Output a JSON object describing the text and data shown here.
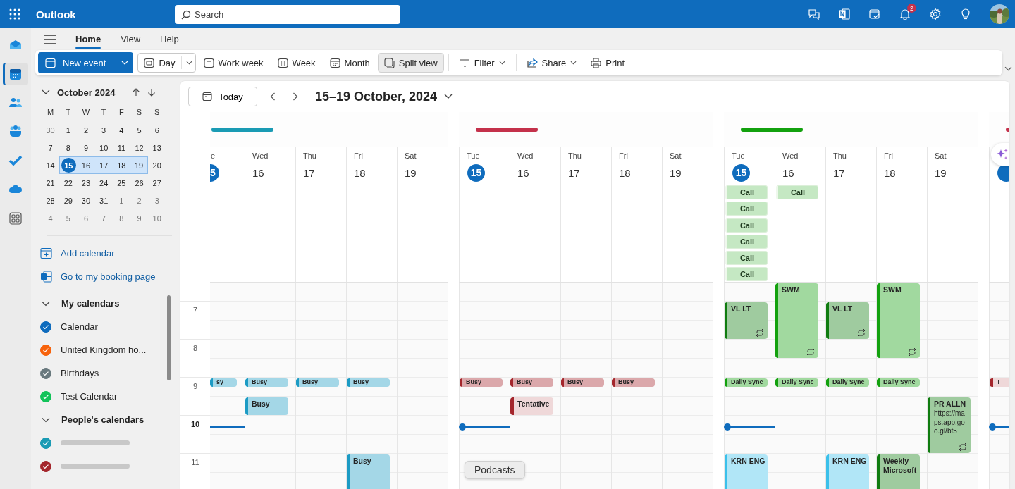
{
  "topbar": {
    "app_name": "Outlook",
    "search": {
      "placeholder": "Search"
    },
    "notification_badge": "2"
  },
  "rail": [
    {
      "kind": "mail",
      "selected": false
    },
    {
      "kind": "calendar",
      "selected": true
    },
    {
      "kind": "people",
      "selected": false
    },
    {
      "kind": "groups",
      "selected": false
    },
    {
      "kind": "todo",
      "selected": false
    },
    {
      "kind": "cloud",
      "selected": false
    },
    {
      "kind": "apps",
      "selected": false
    }
  ],
  "ribbon": {
    "tabs": [
      {
        "label": "Home",
        "selected": true
      },
      {
        "label": "View",
        "selected": false
      },
      {
        "label": "Help",
        "selected": false
      }
    ],
    "toolbar": [
      {
        "label": "New event",
        "kind": "split",
        "selected": false
      },
      {
        "label": "Day",
        "kind": "dropdown",
        "selected": false
      },
      {
        "label": "Work week",
        "kind": "view",
        "selected": false
      },
      {
        "label": "Week",
        "kind": "view",
        "selected": false
      },
      {
        "label": "Month",
        "kind": "view",
        "selected": false
      },
      {
        "label": "Split view",
        "kind": "view",
        "selected": true
      },
      {
        "label": "Filter",
        "kind": "menu",
        "selected": false
      },
      {
        "label": "Share",
        "kind": "menu",
        "selected": false
      },
      {
        "label": "Print",
        "kind": "action",
        "selected": false
      }
    ]
  },
  "mini_calendar": {
    "title": "October 2024",
    "weekdays": [
      "M",
      "T",
      "W",
      "T",
      "F",
      "S",
      "S"
    ],
    "weeks": [
      [
        {
          "d": "30",
          "muted": true,
          "selected": false,
          "today": false
        },
        {
          "d": "1",
          "muted": false,
          "selected": false,
          "today": false
        },
        {
          "d": "2",
          "muted": false,
          "selected": false,
          "today": false
        },
        {
          "d": "3",
          "muted": false,
          "selected": false,
          "today": false
        },
        {
          "d": "4",
          "muted": false,
          "selected": false,
          "today": false
        },
        {
          "d": "5",
          "muted": false,
          "selected": false,
          "today": false
        },
        {
          "d": "6",
          "muted": false,
          "selected": false,
          "today": false
        }
      ],
      [
        {
          "d": "7",
          "muted": false,
          "selected": false,
          "today": false
        },
        {
          "d": "8",
          "muted": false,
          "selected": false,
          "today": false
        },
        {
          "d": "9",
          "muted": false,
          "selected": false,
          "today": false
        },
        {
          "d": "10",
          "muted": false,
          "selected": false,
          "today": false
        },
        {
          "d": "11",
          "muted": false,
          "selected": false,
          "today": false
        },
        {
          "d": "12",
          "muted": false,
          "selected": false,
          "today": false
        },
        {
          "d": "13",
          "muted": false,
          "selected": false,
          "today": false
        }
      ],
      [
        {
          "d": "14",
          "muted": false,
          "selected": false,
          "today": false
        },
        {
          "d": "15",
          "muted": false,
          "selected": true,
          "today": true
        },
        {
          "d": "16",
          "muted": false,
          "selected": true,
          "today": false
        },
        {
          "d": "17",
          "muted": false,
          "selected": true,
          "today": false
        },
        {
          "d": "18",
          "muted": false,
          "selected": true,
          "today": false
        },
        {
          "d": "19",
          "muted": false,
          "selected": true,
          "today": false
        },
        {
          "d": "20",
          "muted": false,
          "selected": false,
          "today": false
        }
      ],
      [
        {
          "d": "21",
          "muted": false,
          "selected": false,
          "today": false
        },
        {
          "d": "22",
          "muted": false,
          "selected": false,
          "today": false
        },
        {
          "d": "23",
          "muted": false,
          "selected": false,
          "today": false
        },
        {
          "d": "24",
          "muted": false,
          "selected": false,
          "today": false
        },
        {
          "d": "25",
          "muted": false,
          "selected": false,
          "today": false
        },
        {
          "d": "26",
          "muted": false,
          "selected": false,
          "today": false
        },
        {
          "d": "27",
          "muted": false,
          "selected": false,
          "today": false
        }
      ],
      [
        {
          "d": "28",
          "muted": false,
          "selected": false,
          "today": false
        },
        {
          "d": "29",
          "muted": false,
          "selected": false,
          "today": false
        },
        {
          "d": "30",
          "muted": false,
          "selected": false,
          "today": false
        },
        {
          "d": "31",
          "muted": false,
          "selected": false,
          "today": false
        },
        {
          "d": "1",
          "muted": true,
          "selected": false,
          "today": false
        },
        {
          "d": "2",
          "muted": true,
          "selected": false,
          "today": false
        },
        {
          "d": "3",
          "muted": true,
          "selected": false,
          "today": false
        }
      ],
      [
        {
          "d": "4",
          "muted": true,
          "selected": false,
          "today": false
        },
        {
          "d": "5",
          "muted": true,
          "selected": false,
          "today": false
        },
        {
          "d": "6",
          "muted": true,
          "selected": false,
          "today": false
        },
        {
          "d": "7",
          "muted": true,
          "selected": false,
          "today": false
        },
        {
          "d": "8",
          "muted": true,
          "selected": false,
          "today": false
        },
        {
          "d": "9",
          "muted": true,
          "selected": false,
          "today": false
        },
        {
          "d": "10",
          "muted": true,
          "selected": false,
          "today": false
        }
      ]
    ]
  },
  "links": [
    {
      "label": "Add calendar"
    },
    {
      "label": "Go to my booking page"
    }
  ],
  "calendar_groups": [
    {
      "title": "My calendars",
      "expanded": true,
      "items": [
        {
          "name": "Calendar",
          "color": "#0f6cbd",
          "checked": true
        },
        {
          "name": "United Kingdom ho...",
          "color": "#f7630c",
          "checked": true
        },
        {
          "name": "Birthdays",
          "color": "#69797e",
          "checked": true
        },
        {
          "name": "Test Calendar",
          "color": "#13c35a",
          "checked": true
        }
      ]
    },
    {
      "title": "People's calendars",
      "expanded": true,
      "items": [
        {
          "color": "#1a9bb4",
          "checked": true
        },
        {
          "color": "#a4262c",
          "checked": true
        }
      ]
    }
  ],
  "calendar": {
    "today_button": "Today",
    "range_title": "15–19 October, 2024",
    "hours": [
      {
        "label": "7",
        "current": false
      },
      {
        "label": "8",
        "current": false
      },
      {
        "label": "9",
        "current": false
      },
      {
        "label": "10",
        "current": true
      },
      {
        "label": "11",
        "current": false
      }
    ],
    "panels": [
      {
        "color": "#1a9bb4",
        "days": [
          {
            "label": "e",
            "date": "5",
            "today": true,
            "events": [
              {
                "title": "sy",
                "kind": "busy",
                "color": "#1c9bc4",
                "recurring": false
              }
            ]
          },
          {
            "label": "Wed",
            "date": "16",
            "today": false,
            "events": [
              {
                "title": "Busy",
                "kind": "busy",
                "color": "#1c9bc4",
                "recurring": false
              },
              {
                "title": "Busy",
                "kind": "busy",
                "color": "#1c9bc4",
                "recurring": false
              }
            ]
          },
          {
            "label": "Thu",
            "date": "17",
            "today": false,
            "events": [
              {
                "title": "Busy",
                "kind": "busy",
                "color": "#1c9bc4",
                "recurring": false
              }
            ]
          },
          {
            "label": "Fri",
            "date": "18",
            "today": false,
            "events": [
              {
                "title": "Busy",
                "kind": "busy",
                "color": "#1c9bc4",
                "recurring": false
              },
              {
                "title": "Busy",
                "kind": "busy",
                "color": "#1c9bc4"
              }
            ]
          },
          {
            "label": "Sat",
            "date": "19",
            "today": false
          }
        ]
      },
      {
        "color": "#c4314b",
        "days": [
          {
            "label": "Tue",
            "date": "15",
            "today": true,
            "events": [
              {
                "title": "Busy",
                "kind": "busy",
                "color": "#a4262c",
                "recurring": false
              }
            ]
          },
          {
            "label": "Wed",
            "date": "16",
            "today": false,
            "events": [
              {
                "title": "Busy",
                "kind": "busy",
                "color": "#a4262c",
                "recurring": false
              },
              {
                "title": "Tentative",
                "kind": "tentative",
                "color": "#a4262c",
                "recurring": false
              }
            ]
          },
          {
            "label": "Thu",
            "date": "17",
            "today": false,
            "events": [
              {
                "title": "Busy",
                "kind": "busy",
                "color": "#a4262c",
                "recurring": false
              }
            ]
          },
          {
            "label": "Fri",
            "date": "18",
            "today": false,
            "events": [
              {
                "title": "Busy",
                "kind": "busy",
                "color": "#a4262c",
                "recurring": false
              }
            ]
          },
          {
            "label": "Sat",
            "date": "19",
            "today": false
          }
        ]
      },
      {
        "color": "#13a10e",
        "days": [
          {
            "label": "Tue",
            "date": "15",
            "today": true,
            "all_day": [
              {
                "title": "Call"
              },
              {
                "title": "Call"
              },
              {
                "title": "Call"
              },
              {
                "title": "Call"
              },
              {
                "title": "Call"
              },
              {
                "title": "Call"
              }
            ],
            "events": [
              {
                "title": "VL LT",
                "kind": "busy",
                "color": "#107c10",
                "recurring": true
              },
              {
                "title": "Daily Sync",
                "kind": "busy",
                "color": "#13a10e",
                "recurring": false
              },
              {
                "title": "KRN ENG",
                "kind": "busy",
                "color": "#3bc0ea"
              }
            ]
          },
          {
            "label": "Wed",
            "date": "16",
            "today": false,
            "all_day": [
              {
                "title": "Call"
              }
            ],
            "events": [
              {
                "title": "SWM",
                "kind": "busy",
                "color": "#13a10e",
                "recurring": true
              },
              {
                "title": "Daily Sync",
                "kind": "busy",
                "color": "#13a10e",
                "recurring": false
              }
            ]
          },
          {
            "label": "Thu",
            "date": "17",
            "today": false,
            "events": [
              {
                "title": "VL LT",
                "kind": "busy",
                "color": "#107c10",
                "recurring": true
              },
              {
                "title": "Daily Sync",
                "kind": "busy",
                "color": "#13a10e",
                "recurring": false
              },
              {
                "title": "KRN ENG",
                "kind": "busy",
                "color": "#3bc0ea"
              }
            ]
          },
          {
            "label": "Fri",
            "date": "18",
            "today": false,
            "events": [
              {
                "title": "SWM",
                "kind": "busy",
                "color": "#13a10e",
                "recurring": true
              },
              {
                "title": "Daily Sync",
                "kind": "busy",
                "color": "#13a10e",
                "recurring": false
              },
              {
                "title": "Weekly Microsoft",
                "kind": "busy",
                "color": "#107c10"
              }
            ]
          },
          {
            "label": "Sat",
            "date": "19",
            "today": false,
            "events": [
              {
                "title": "PR ALLN",
                "details": "https://maps.app.goo.gl/bf5",
                "kind": "busy",
                "color": "#107c10",
                "recurring": true
              }
            ]
          }
        ]
      },
      {
        "color": "#c4314b",
        "days": [
          {
            "today": true,
            "events": [
              {
                "title": "T",
                "kind": "tentative",
                "color": "#a4262c"
              }
            ]
          }
        ]
      }
    ]
  },
  "dock_tooltip": "Podcasts"
}
